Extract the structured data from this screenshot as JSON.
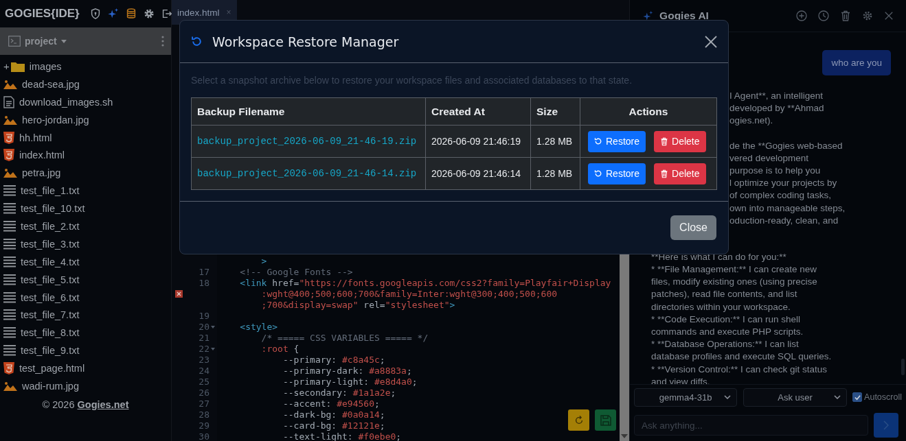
{
  "sidebar": {
    "brand": "GOGIES{IDE}",
    "project": "project",
    "files": [
      {
        "name": "images",
        "kind": "folder",
        "expander": "+"
      },
      {
        "name": "dead-sea.jpg",
        "kind": "image"
      },
      {
        "name": "download_images.sh",
        "kind": "script"
      },
      {
        "name": "hero-jordan.jpg",
        "kind": "image"
      },
      {
        "name": "hh.html",
        "kind": "html"
      },
      {
        "name": "index.html",
        "kind": "html"
      },
      {
        "name": "petra.jpg",
        "kind": "image"
      },
      {
        "name": "test_file_1.txt",
        "kind": "text"
      },
      {
        "name": "test_file_10.txt",
        "kind": "text"
      },
      {
        "name": "test_file_2.txt",
        "kind": "text"
      },
      {
        "name": "test_file_3.txt",
        "kind": "text"
      },
      {
        "name": "test_file_4.txt",
        "kind": "text"
      },
      {
        "name": "test_file_5.txt",
        "kind": "text"
      },
      {
        "name": "test_file_6.txt",
        "kind": "text"
      },
      {
        "name": "test_file_7.txt",
        "kind": "text"
      },
      {
        "name": "test_file_8.txt",
        "kind": "text"
      },
      {
        "name": "test_file_9.txt",
        "kind": "text"
      },
      {
        "name": "test_page.html",
        "kind": "html"
      },
      {
        "name": "wadi-rum.jpg",
        "kind": "image"
      }
    ],
    "footer": {
      "prefix": "© 2026",
      "link": "Gogies.net"
    }
  },
  "editor": {
    "tabs": [
      {
        "label": "index.html",
        "close": "×",
        "selected": true
      }
    ],
    "lines": [
      {
        "tokens": [
          {
            "t": "        >",
            "kind": "tag"
          }
        ]
      },
      {
        "number": "17",
        "tokens": [
          {
            "t": "    <!-- Google Fonts -->",
            "kind": "comment"
          }
        ]
      },
      {
        "number": "18",
        "tokens": [
          {
            "t": "    <link",
            "kind": "tag"
          },
          {
            "t": " href",
            "kind": "attr"
          },
          {
            "t": "=",
            "kind": "text"
          },
          {
            "t": "\"https://fonts.googleapis.com/css2?family=Playfair+Display",
            "kind": "str"
          }
        ]
      },
      {
        "error": true,
        "tokens": [
          {
            "t": "        :wght@400;500;600;700&family=Inter:wght@300;400;500;600",
            "kind": "str"
          }
        ]
      },
      {
        "tokens": [
          {
            "t": "        ;700&display=swap\"",
            "kind": "str"
          },
          {
            "t": " rel",
            "kind": "attr"
          },
          {
            "t": "=",
            "kind": "text"
          },
          {
            "t": "\"stylesheet\"",
            "kind": "str"
          },
          {
            "t": ">",
            "kind": "tag"
          }
        ]
      },
      {
        "number": "19"
      },
      {
        "number": "20",
        "fold": true,
        "tokens": [
          {
            "t": "    <style>",
            "kind": "tag"
          }
        ]
      },
      {
        "number": "21",
        "tokens": [
          {
            "t": "        /* ===== CSS VARIABLES ===== */",
            "kind": "comment"
          }
        ]
      },
      {
        "number": "22",
        "fold": true,
        "tokens": [
          {
            "t": "        :root",
            "kind": "str"
          },
          {
            "t": " {",
            "kind": "text"
          }
        ]
      },
      {
        "number": "23",
        "tokens": [
          {
            "t": "            --primary: ",
            "kind": "text"
          },
          {
            "t": "#c8a45c",
            "kind": "str"
          },
          {
            "t": ";",
            "kind": "text"
          }
        ]
      },
      {
        "number": "24",
        "tokens": [
          {
            "t": "            --primary-dark: ",
            "kind": "text"
          },
          {
            "t": "#a8883a",
            "kind": "str"
          },
          {
            "t": ";",
            "kind": "text"
          }
        ]
      },
      {
        "number": "25",
        "tokens": [
          {
            "t": "            --primary-light: ",
            "kind": "text"
          },
          {
            "t": "#e8d4a0",
            "kind": "str"
          },
          {
            "t": ";",
            "kind": "text"
          }
        ]
      },
      {
        "number": "26",
        "tokens": [
          {
            "t": "            --secondary: ",
            "kind": "text"
          },
          {
            "t": "#1a1a2e",
            "kind": "str"
          },
          {
            "t": ";",
            "kind": "text"
          }
        ]
      },
      {
        "number": "27",
        "tokens": [
          {
            "t": "            --accent: ",
            "kind": "text"
          },
          {
            "t": "#e94560",
            "kind": "str"
          },
          {
            "t": ";",
            "kind": "text"
          }
        ]
      },
      {
        "number": "28",
        "tokens": [
          {
            "t": "            --dark-bg: ",
            "kind": "text"
          },
          {
            "t": "#0a0a14",
            "kind": "str"
          },
          {
            "t": ";",
            "kind": "text"
          }
        ]
      },
      {
        "number": "29",
        "tokens": [
          {
            "t": "            --card-bg: ",
            "kind": "text"
          },
          {
            "t": "#12121e",
            "kind": "str"
          },
          {
            "t": ";",
            "kind": "text"
          }
        ]
      },
      {
        "number": "30",
        "tokens": [
          {
            "t": "            --text-light: ",
            "kind": "text"
          },
          {
            "t": "#f0ebe0",
            "kind": "str"
          },
          {
            "t": ";",
            "kind": "text"
          }
        ]
      }
    ]
  },
  "modal": {
    "title": "Workspace Restore Manager",
    "description": "Select a snapshot archive below to restore your workspace files and associated databases to that state.",
    "columns": [
      "Backup Filename",
      "Created At",
      "Size",
      "Actions"
    ],
    "rows": [
      {
        "filename": "backup_project_2026-06-09_21-46-19.zip",
        "created": "2026-06-09 21:46:19",
        "size": "1.28 MB",
        "restore": "Restore",
        "delete": "Delete"
      },
      {
        "filename": "backup_project_2026-06-09_21-46-14.zip",
        "created": "2026-06-09 21:46:14",
        "size": "1.28 MB",
        "restore": "Restore",
        "delete": "Delete"
      }
    ],
    "close": "Close"
  },
  "chat": {
    "title": "Gogies AI",
    "user_message": "who are you",
    "fragments": [
      [
        "I Agent**, an intelligent",
        "developed by **Ahmad",
        "ogies.net)."
      ],
      [
        "de the **Gogies web-based",
        "vered development",
        "purpose is to help you",
        "l optimize your projects by",
        "of complex coding tasks,",
        "own into manageable steps,",
        "oduction-ready, clean, and"
      ]
    ],
    "lines": [
      "**Here is what I can do for you:**",
      "* **File Management:** I can create new",
      "files, modify existing ones (using precise",
      "patches), read file contents, and list",
      "directories within your workspace.",
      "* **Code Execution:** I can run shell",
      "commands and execute PHP scripts.",
      "* **Database Operations:** I can list",
      "database profiles and execute SQL queries.",
      "* **Version Control:** I can check git status",
      "and view diffs."
    ],
    "model": "gemma4-31b",
    "mode": "Ask user",
    "autoscroll": {
      "label": "Autoscroll",
      "checked": true
    },
    "input": {
      "placeholder": "Ask anything..."
    }
  }
}
